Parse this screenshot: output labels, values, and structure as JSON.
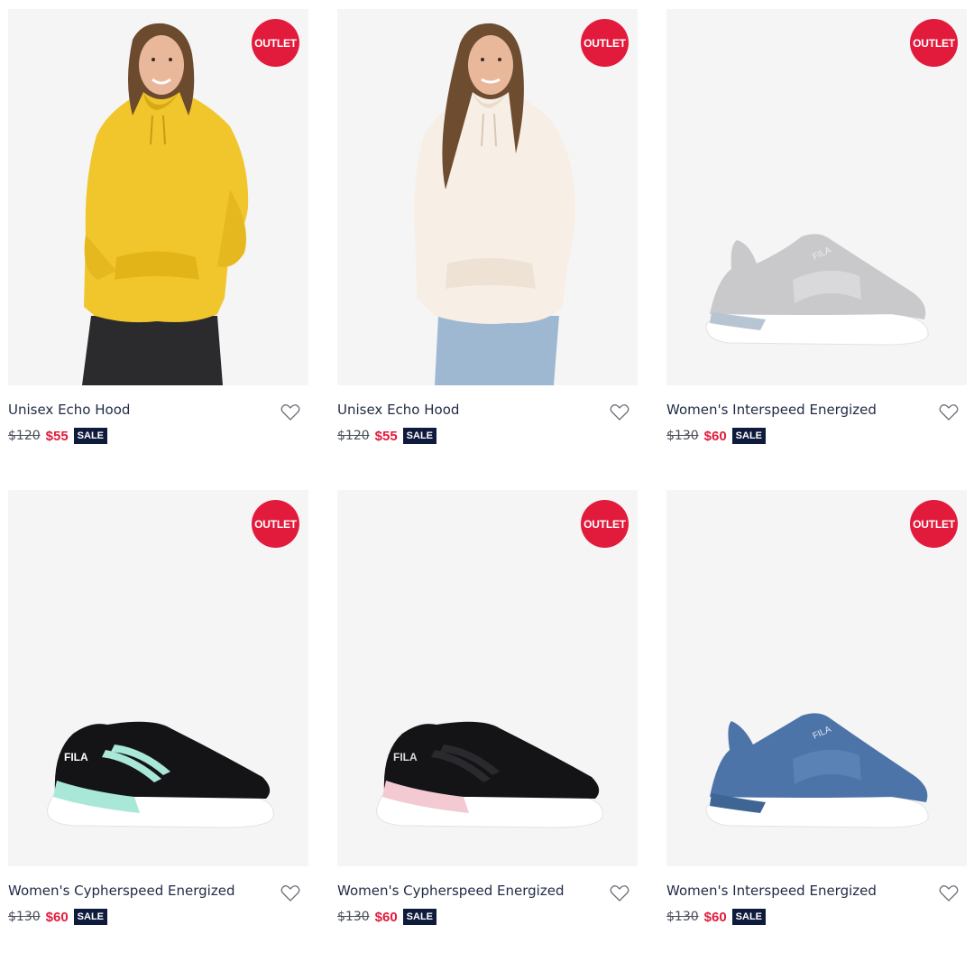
{
  "products": [
    {
      "name": "Unisex Echo Hood",
      "badge": "OUTLET",
      "old_price": "$120",
      "new_price": "$55",
      "sale_label": "SALE",
      "image": "yellow-hoodie"
    },
    {
      "name": "Unisex Echo Hood",
      "badge": "OUTLET",
      "old_price": "$120",
      "new_price": "$55",
      "sale_label": "SALE",
      "image": "cream-hoodie"
    },
    {
      "name": "Women's Interspeed Energized",
      "badge": "OUTLET",
      "old_price": "$130",
      "new_price": "$60",
      "sale_label": "SALE",
      "image": "grey-slip-on-sneaker"
    },
    {
      "name": "Women's Cypherspeed Energized",
      "badge": "OUTLET",
      "old_price": "$130",
      "new_price": "$60",
      "sale_label": "SALE",
      "image": "black-mint-sneaker"
    },
    {
      "name": "Women's Cypherspeed Energized",
      "badge": "OUTLET",
      "old_price": "$130",
      "new_price": "$60",
      "sale_label": "SALE",
      "image": "black-pink-sneaker"
    },
    {
      "name": "Women's Interspeed Energized",
      "badge": "OUTLET",
      "old_price": "$130",
      "new_price": "$60",
      "sale_label": "SALE",
      "image": "blue-slip-on-sneaker"
    }
  ],
  "colors": {
    "accent_red": "#e21b3c",
    "navy": "#0f1b3d",
    "tile_bg": "#f5f5f5"
  }
}
